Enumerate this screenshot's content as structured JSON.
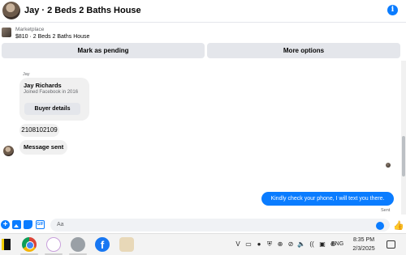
{
  "header": {
    "title": "Jay · 2 Beds 2 Baths House",
    "info_glyph": "i"
  },
  "marketplace": {
    "label": "Marketplace",
    "listing": "$810 · 2 Beds 2 Baths House",
    "mark_pending_label": "Mark as pending",
    "more_options_label": "More options"
  },
  "messages": {
    "sender_name": "Jay",
    "profile": {
      "name": "Jay Richards",
      "joined": "Joined Facebook in 2016",
      "buyer_button": "Buyer details"
    },
    "phone": "2108102109",
    "message_sent": "Message sent",
    "outgoing": "Kindly check your phone, I will text you there.",
    "status": "Sent"
  },
  "composer": {
    "placeholder": "Aa",
    "plus_glyph": "+",
    "gif_label": "GIF",
    "like_glyph": "👍"
  },
  "taskbar": {
    "facebook_glyph": "f",
    "tray_icons": [
      "V",
      "▭",
      "●",
      "⛨",
      "⊕",
      "⊘",
      "🔈",
      "((",
      "▣",
      "⊛"
    ],
    "language": "ENG",
    "time": "8:35 PM",
    "date": "2/3/2025"
  },
  "colors": {
    "accent": "#0a7cff",
    "bubble_in": "#f0f0f0",
    "button_bg": "#e4e6eb"
  }
}
